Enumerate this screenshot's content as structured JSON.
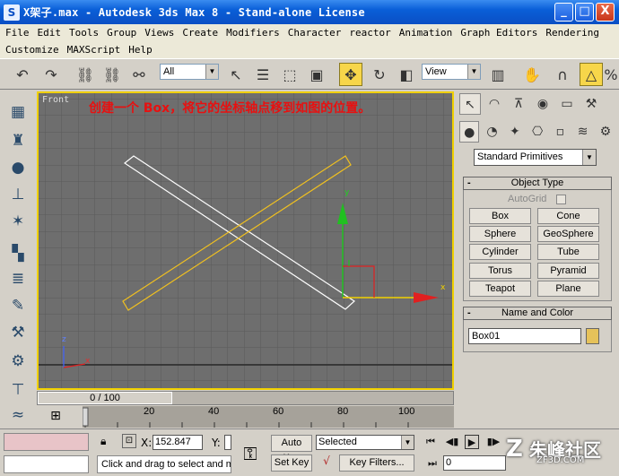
{
  "window": {
    "title": "X架子.max  -  Autodesk 3ds Max 8  -  Stand-alone License",
    "app_icon": "S",
    "minimize": "_",
    "maximize": "□",
    "close": "X"
  },
  "menus": {
    "row1": [
      "File",
      "Edit",
      "Tools",
      "Group",
      "Views",
      "Create",
      "Modifiers",
      "Character",
      "reactor",
      "Animation",
      "Graph Editors",
      "Rendering"
    ],
    "row2": [
      "Customize",
      "MAXScript",
      "Help"
    ]
  },
  "toolbar": {
    "selection_filter": "All",
    "reference_coord": "View"
  },
  "viewport": {
    "label": "Front",
    "note": "创建一个 Box，将它的坐标轴点移到如图的位置。",
    "gizmo_x": "x",
    "gizmo_y": "y",
    "axis_x": "x",
    "axis_z": "z",
    "colors": {
      "box_selected": "#f0c020",
      "box_white": "#ffffff",
      "grid": "#5a5a5a",
      "bg": "#6e6e6e"
    }
  },
  "timeline": {
    "frame_display": "0 / 100",
    "ticks": [
      "20",
      "40",
      "60",
      "80",
      "100"
    ]
  },
  "command_panel": {
    "category": "Standard Primitives",
    "object_type": {
      "header": "Object Type",
      "autogrid": "AutoGrid",
      "buttons": [
        "Box",
        "Cone",
        "Sphere",
        "GeoSphere",
        "Cylinder",
        "Tube",
        "Torus",
        "Pyramid",
        "Teapot",
        "Plane"
      ]
    },
    "name_and_color": {
      "header": "Name and Color",
      "name_value": "Box01",
      "color": "#e6c25a"
    }
  },
  "status": {
    "x_label": "X:",
    "x_value": "152.847",
    "y_label": "Y:",
    "auto_key": "Auto Key",
    "set_key": "Set Key",
    "key_mode": "Selected",
    "key_filters": "Key Filters...",
    "frame_value": "0",
    "prompt": "Click and drag to select and mo"
  },
  "watermark": {
    "main": "朱峰社区",
    "sub": "ZF3D.COM"
  }
}
